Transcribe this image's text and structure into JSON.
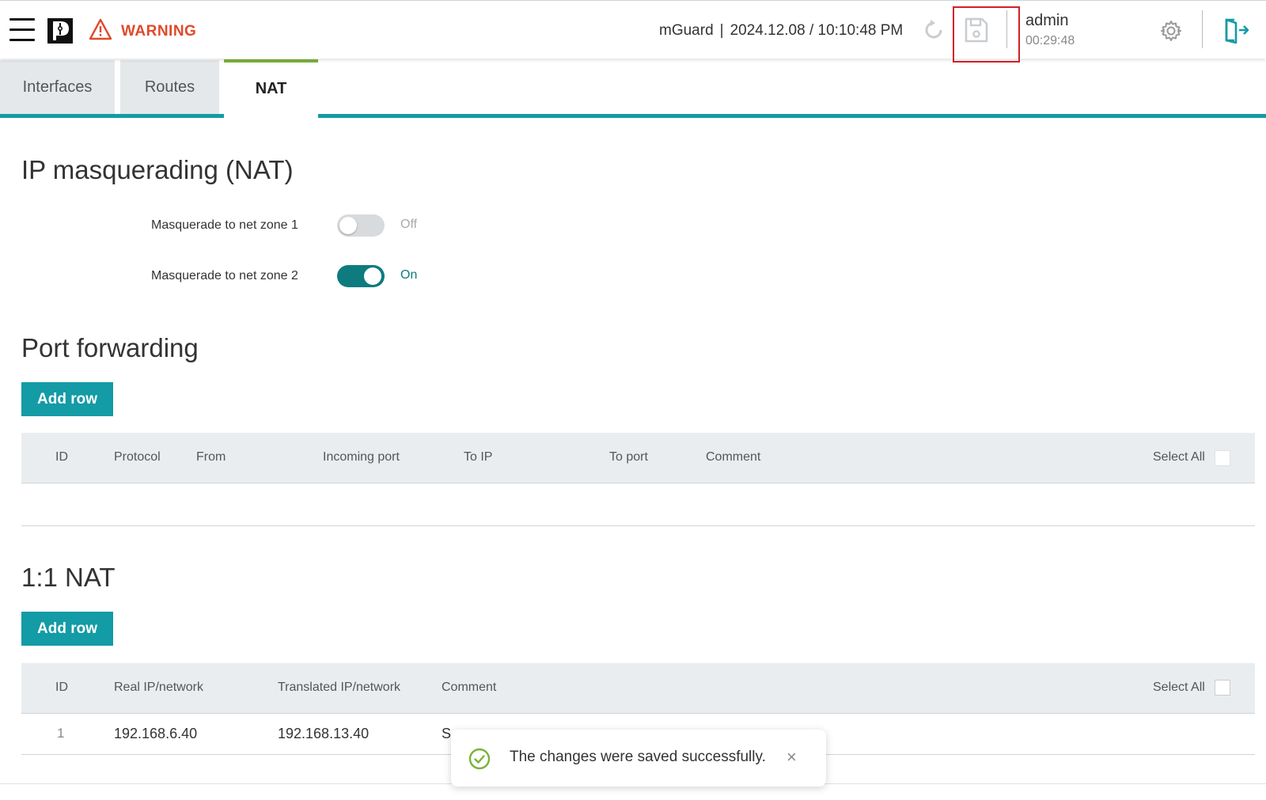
{
  "header": {
    "warning_label": "WARNING",
    "device_name": "mGuard",
    "datetime": "2024.12.08 / 10:10:48 PM",
    "separator": "|",
    "user": "admin",
    "session_timer": "00:29:48"
  },
  "icons": {
    "menu": "hamburger-menu-icon",
    "logo": "phoenix-contact-logo",
    "warning": "warning-triangle-icon",
    "undo": "undo-icon",
    "save": "save-disk-icon",
    "settings": "gear-icon",
    "logout": "logout-door-icon",
    "toast": "check-circle-icon"
  },
  "colors": {
    "accent": "#139ba6",
    "toggle_on": "#0e7b7f",
    "warning": "#e0492a",
    "active_tab_marker": "#79b33a",
    "highlight_box": "#d21f27"
  },
  "tabs": [
    {
      "label": "Interfaces",
      "active": false
    },
    {
      "label": "Routes",
      "active": false
    },
    {
      "label": "NAT",
      "active": true
    }
  ],
  "masquerading": {
    "title": "IP masquerading (NAT)",
    "zone1": {
      "label": "Masquerade to net zone 1",
      "state": "Off",
      "enabled": false
    },
    "zone2": {
      "label": "Masquerade to net zone 2",
      "state": "On",
      "enabled": true
    }
  },
  "port_forwarding": {
    "title": "Port forwarding",
    "add_row": "Add row",
    "columns": [
      "ID",
      "Protocol",
      "From",
      "Incoming port",
      "To IP",
      "To port",
      "Comment"
    ],
    "select_all": "Select All",
    "rows": []
  },
  "one_to_one_nat": {
    "title": "1:1 NAT",
    "add_row": "Add row",
    "columns": [
      "ID",
      "Real IP/network",
      "Translated IP/network",
      "Comment"
    ],
    "select_all": "Select All",
    "rows": [
      {
        "id": "1",
        "real": "192.168.6.40",
        "translated": "192.168.13.40",
        "comment": "S"
      }
    ]
  },
  "toast": {
    "message": "The changes were saved successfully.",
    "close": "×"
  }
}
